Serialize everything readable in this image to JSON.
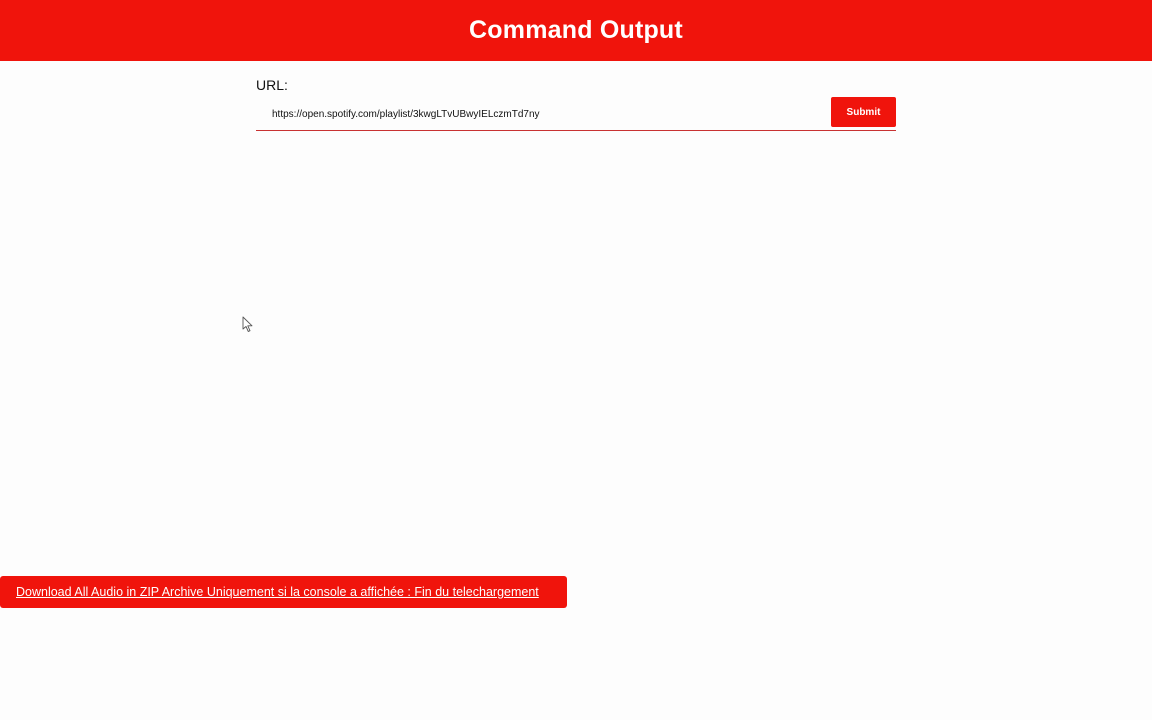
{
  "header": {
    "title": "Command Output"
  },
  "form": {
    "url_label": "URL:",
    "url_value": "https://open.spotify.com/playlist/3kwgLTvUBwyIELczmTd7ny",
    "submit_label": "Submit"
  },
  "download": {
    "link_text": "Download All Audio in ZIP Archive Uniquement si la console a affichée : Fin du telechargement"
  },
  "cursor": {
    "icon": "arrow-cursor-icon"
  },
  "colors": {
    "accent": "#f0140c",
    "background": "#fdfdfd",
    "text": "#111111",
    "underline": "#c83232"
  }
}
